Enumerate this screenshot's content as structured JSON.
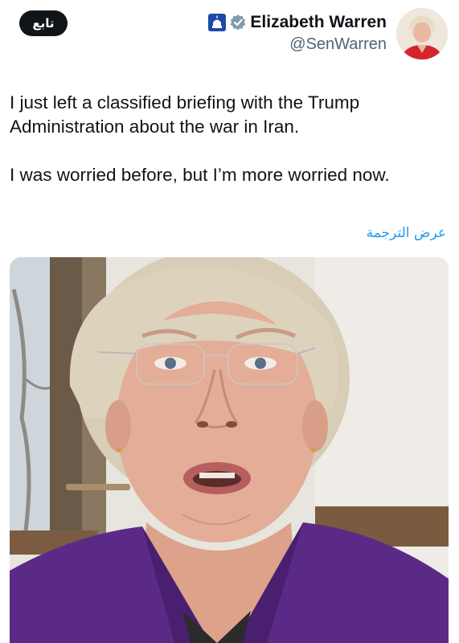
{
  "header": {
    "follow_label": "تابع",
    "display_name": "Elizabeth Warren",
    "handle": "@SenWarren",
    "icons": [
      "capitol-badge-icon",
      "verified-gray-icon"
    ]
  },
  "tweet": {
    "paragraphs": [
      "I just left a classified briefing with the Trump Administration about the war in Iran.",
      "I was worried before, but I’m more worried now."
    ],
    "translate_label": "عرض الترجمة"
  },
  "media": {
    "type": "video-still",
    "description_icon": "video-frame"
  },
  "colors": {
    "text": "#0f1419",
    "secondary": "#536471",
    "link": "#1d9bf0",
    "jacket": "#5b2a86",
    "capitol_badge": "#1d4aa8"
  }
}
